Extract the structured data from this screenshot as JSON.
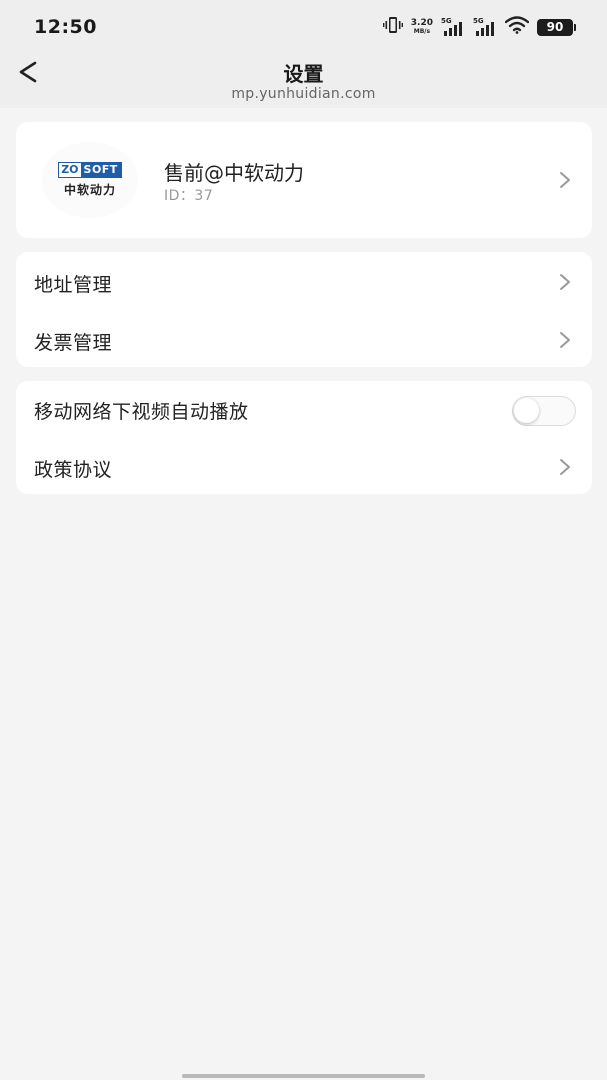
{
  "status_bar": {
    "time": "12:50",
    "net_speed_value": "3.20",
    "net_speed_unit": "MB/s",
    "sim1_gen": "5G",
    "sim2_gen": "5G",
    "battery": "90",
    "icons": [
      "vibrate-icon",
      "signal-icon",
      "wifi-icon",
      "battery-icon"
    ]
  },
  "nav": {
    "title": "设置",
    "subtitle": "mp.yunhuidian.com",
    "back_icon": "back-arrow-icon"
  },
  "profile": {
    "logo_zo": "ZO",
    "logo_soft": "SOFT",
    "logo_cn": "中软动力",
    "name": "售前@中软动力",
    "id_text": "ID：37"
  },
  "management": {
    "items": [
      {
        "label": "地址管理"
      },
      {
        "label": "发票管理"
      }
    ]
  },
  "settings": {
    "autoplay_label": "移动网络下视频自动播放",
    "autoplay_on": false,
    "policy_label": "政策协议"
  },
  "colors": {
    "background": "#f4f4f4",
    "header": "#eeeeee",
    "card": "#ffffff",
    "logo_blue": "#1e5ea8",
    "chevron": "#999999"
  }
}
